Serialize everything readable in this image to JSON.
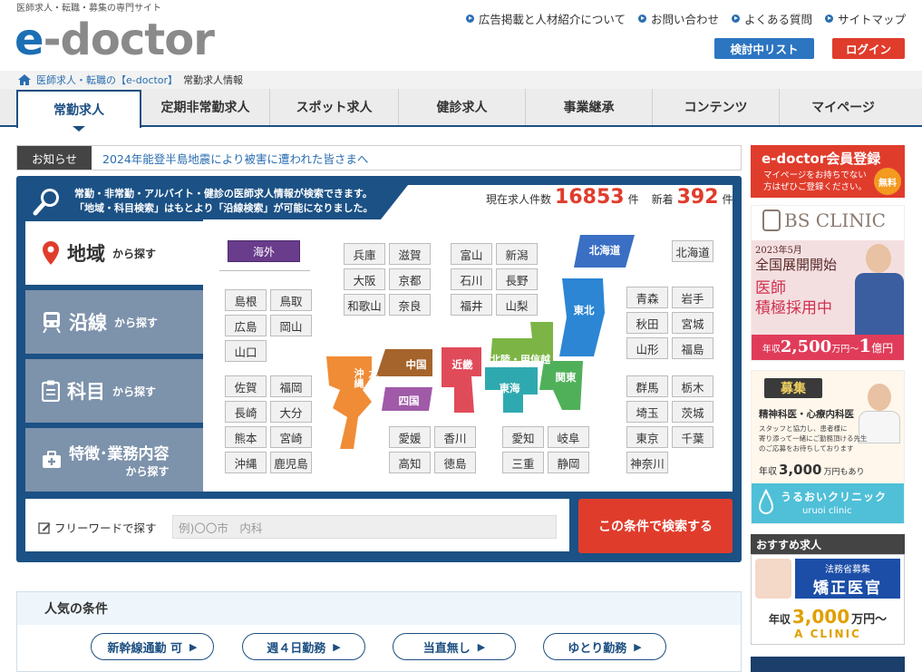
{
  "header": {
    "tagline": "医師求人・転職・募集の専門サイト",
    "logo_e": "e",
    "logo_rest": "-doctor",
    "links": [
      "広告掲載と人材紹介について",
      "お問い合わせ",
      "よくある質問",
      "サイトマップ"
    ],
    "list_btn": "検討中リスト",
    "login_btn": "ログイン"
  },
  "breadcrumb": {
    "link": "医師求人・転職の【e-doctor】",
    "current": "常勤求人情報"
  },
  "nav": [
    "常勤求人",
    "定期非常勤求人",
    "スポット求人",
    "健診求人",
    "事業継承",
    "コンテンツ",
    "マイページ"
  ],
  "notice": {
    "label": "お知らせ",
    "text": "2024年能登半島地震により被害に遭われた皆さまへ"
  },
  "search": {
    "intro1": "常勤・非常勤・アルバイト・健診の医師求人情報が検索できます。",
    "intro2": "「地域・科目検索」はもとより「沿線検索」が可能になりました。",
    "count_label": "現在求人件数",
    "count": "16853",
    "count_unit": "件",
    "new_label": "新着",
    "new_count": "392",
    "new_unit": "件",
    "tabs": [
      {
        "big": "地域",
        "small": "から探す"
      },
      {
        "big": "沿線",
        "small": "から探す"
      },
      {
        "big": "科目",
        "small": "から探す"
      },
      {
        "big": "特徴･業務内容",
        "small": "から探す"
      }
    ],
    "kaigai": "海外",
    "regions": {
      "hokkaido": "北海道",
      "tohoku": "東北",
      "kanto": "関東",
      "hokuriku": "北陸・甲信越",
      "tokai": "東海",
      "kinki": "近畿",
      "chugoku": "中国",
      "shikoku": "四国",
      "kyushu": "九州・沖縄"
    },
    "prefs": {
      "hokkaido": "北海道",
      "tohoku": [
        "青森",
        "岩手",
        "秋田",
        "宮城",
        "山形",
        "福島"
      ],
      "kanto": [
        "群馬",
        "栃木",
        "埼玉",
        "茨城",
        "東京",
        "千葉",
        "神奈川"
      ],
      "kinki": [
        "兵庫",
        "滋賀",
        "大阪",
        "京都",
        "和歌山",
        "奈良"
      ],
      "hokuriku": [
        "富山",
        "新潟",
        "石川",
        "長野",
        "福井",
        "山梨"
      ],
      "chugoku": [
        "島根",
        "鳥取",
        "広島",
        "岡山",
        "山口"
      ],
      "kyushu": [
        "佐賀",
        "福岡",
        "長崎",
        "大分",
        "熊本",
        "宮崎",
        "沖縄",
        "鹿児島"
      ],
      "shikoku": [
        "愛媛",
        "香川",
        "高知",
        "徳島"
      ],
      "tokai": [
        "愛知",
        "岐阜",
        "三重",
        "静岡"
      ]
    },
    "free_label": "フリーワードで探す",
    "free_placeholder": "例)〇〇市　内科",
    "submit": "この条件で検索する"
  },
  "popular": {
    "title": "人気の条件",
    "items": [
      "新幹線通勤 可",
      "週４日勤務",
      "当直無し",
      "ゆとり勤務"
    ]
  },
  "sidebar": {
    "register_title": "e-doctor会員登録",
    "register_sub1": "マイページをお持ちでない",
    "register_sub2": "方はぜひご登録ください。",
    "register_badge": "無料",
    "bs_logo": "BS CLINIC",
    "bs_line1": "2023年5月",
    "bs_line2": "全国展開開始",
    "bs_line3": "医師",
    "bs_line4": "積極採用中",
    "bs_salary_a": "年収",
    "bs_salary_b": "2,500",
    "bs_salary_c": "万円〜",
    "bs_salary_d": "1",
    "bs_salary_e": "億円",
    "bosyu_head": "募集",
    "bosyu_title": "精神科医・心療内科医",
    "bosyu_l1": "スタッフと協力し、患者様に",
    "bosyu_l2": "寄り添って一緒にご勤務頂ける先生",
    "bosyu_l3": "のご応募をお待ちしております",
    "bosyu_sal_a": "年収",
    "bosyu_sal_b": "3,000",
    "bosyu_sal_c": "万円もあり",
    "uruoi": "うるおいクリニック",
    "uruoi_en": "uruoi clinic",
    "recommend": "おすすめ求人",
    "hom_small": "法務省募集",
    "hom_big": "矯正医官",
    "aclinic_sal_a": "年収",
    "aclinic_sal_b": "3,000",
    "aclinic_sal_c": "万円〜",
    "aclinic": "A CLINIC"
  },
  "colors": {
    "brand": "#1c6fb4",
    "navy": "#1b5185",
    "red": "#e03c2c",
    "tab_grey": "#7d92ab"
  }
}
